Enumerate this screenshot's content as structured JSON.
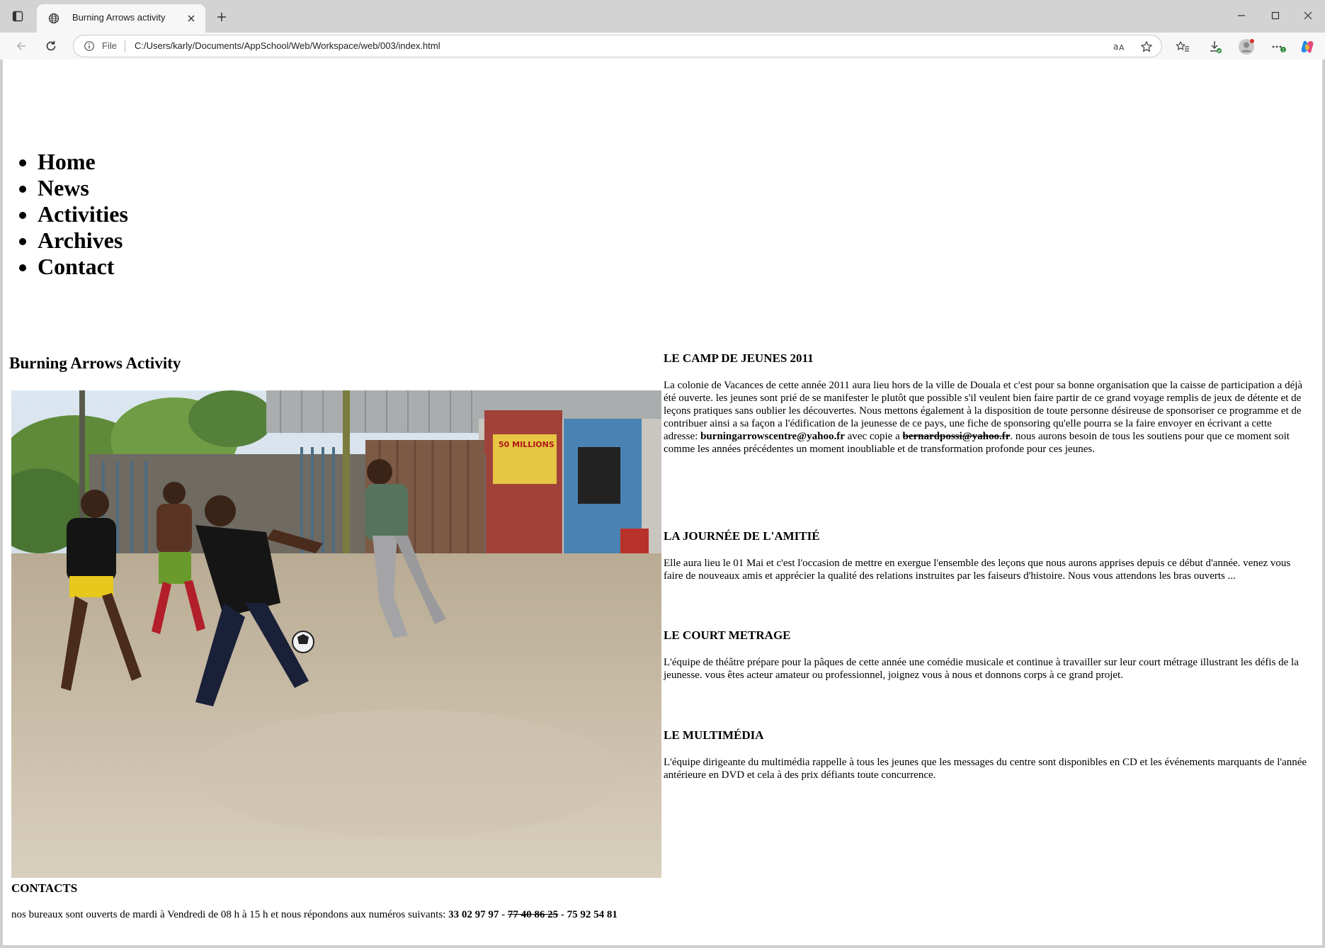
{
  "browser": {
    "tab_title": "Burning Arrows activity",
    "scheme_label": "File",
    "url": "C:/Users/karly/Documents/AppSchool/Web/Workspace/web/003/index.html"
  },
  "page": {
    "menu": [
      "Home",
      "News",
      "Activities",
      "Archives",
      "Contact"
    ],
    "title": "Burning Arrows Activity",
    "articles": [
      {
        "heading": "LE CAMP DE JEUNES 2011",
        "text_before": "La colonie de Vacances de cette année 2011 aura lieu hors de la ville de Douala et c'est pour sa bonne organisation que la caisse de participation a déjà été ouverte. les jeunes sont prié de se manifester le plutôt que possible s'il veulent bien faire partir de ce grand voyage remplis de jeux de détente et de leçons pratiques sans oublier les découvertes. Nous mettons également à la disposition de toute personne désireuse de sponsoriser ce programme et de contribuer ainsi a sa façon a l'édification de la jeunesse de ce pays, une fiche de sponsoring qu'elle pourra se la faire envoyer en écrivant a cette adresse: ",
        "email_primary": "burningarrowscentre@yahoo.fr",
        "text_middle": " avec copie a ",
        "email_old": "bernardpossi@yahoo.fr",
        "text_after": ". nous aurons besoin de tous les soutiens pour que ce moment soit comme les années précédentes un moment inoubliable et de transformation profonde pour ces jeunes."
      },
      {
        "heading": "LA JOURNÉE DE L'AMITIÉ",
        "text": "Elle aura lieu le 01 Mai et c'est l'occasion de mettre en exergue l'ensemble des leçons que nous aurons apprises depuis ce début d'année. venez vous faire de nouveaux amis et apprécier la qualité des relations instruites par les faiseurs d'histoire. Nous vous attendons les bras ouverts ..."
      },
      {
        "heading": "LE COURT METRAGE",
        "text": "L'équipe de théâtre prépare pour la pâques de cette année une comédie musicale et continue à travailler sur leur court métrage illustrant les défis de la jeunesse. vous êtes acteur amateur ou professionnel, joignez vous à nous et donnons corps à ce grand projet."
      },
      {
        "heading": "LE MULTIMÉDIA",
        "text": "L'équipe dirigeante du multimédia rappelle à tous les jeunes que les messages du centre sont disponibles en CD et les événements marquants de l'année antérieure en DVD et cela à des prix défiants toute concurrence."
      }
    ],
    "contacts": {
      "heading": "CONTACTS",
      "text": "nos bureaux sont ouverts de mardi à Vendredi de 08 h à 15 h et nous répondons aux numéros suivants: ",
      "phone1": "33 02 97 97",
      "dash1": " - ",
      "phone_old": "77 40 86 25",
      "dash2": " - ",
      "phone2": "75 92 54 81"
    },
    "photo_poster_text": "50 MILLIONS"
  }
}
